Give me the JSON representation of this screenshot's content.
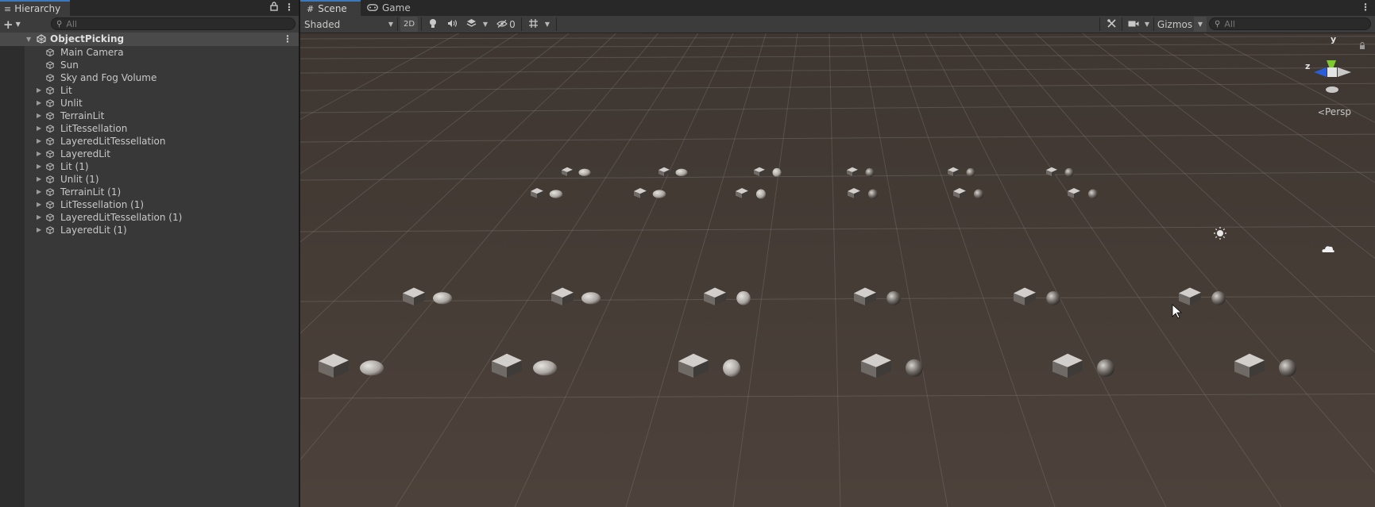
{
  "hierarchy": {
    "tab_label": "Hierarchy",
    "search_placeholder": "All",
    "scene_name": "ObjectPicking",
    "items": [
      {
        "label": "Main Camera",
        "expandable": false
      },
      {
        "label": "Sun",
        "expandable": false
      },
      {
        "label": "Sky and Fog Volume",
        "expandable": false
      },
      {
        "label": "Lit",
        "expandable": true
      },
      {
        "label": "Unlit",
        "expandable": true
      },
      {
        "label": "TerrainLit",
        "expandable": true
      },
      {
        "label": "LitTessellation",
        "expandable": true
      },
      {
        "label": "LayeredLitTessellation",
        "expandable": true
      },
      {
        "label": "LayeredLit",
        "expandable": true
      },
      {
        "label": "Lit (1)",
        "expandable": true
      },
      {
        "label": "Unlit (1)",
        "expandable": true
      },
      {
        "label": "TerrainLit (1)",
        "expandable": true
      },
      {
        "label": "LitTessellation (1)",
        "expandable": true
      },
      {
        "label": "LayeredLitTessellation (1)",
        "expandable": true
      },
      {
        "label": "LayeredLit (1)",
        "expandable": true
      }
    ]
  },
  "scene_view": {
    "tabs": [
      {
        "label": "Scene"
      },
      {
        "label": "Game"
      }
    ],
    "draw_mode": "Shaded",
    "mode_2d": "2D",
    "hidden_count": "0",
    "gizmos_label": "Gizmos",
    "search_placeholder": "All",
    "projection_label": "Persp",
    "axis_y": "y",
    "axis_z": "z"
  },
  "icons": {
    "hierarchy_tab": "hierarchy-list-icon",
    "lock": "lock-icon",
    "menu": "kebab-menu-icon",
    "scene_tab": "grid-icon",
    "game_tab": "gamepad-icon",
    "lighting": "lightbulb-icon",
    "audio": "speaker-icon",
    "effects": "layers-icon",
    "visibility": "eye-slash-icon",
    "grid": "grid-snap-icon",
    "tools": "tools-icon",
    "camera": "camera-icon",
    "sun_light": "sun-icon",
    "cloud_volume": "cloud-icon",
    "cursor": "mouse-pointer-icon"
  },
  "colors": {
    "accent_tab": "#3a79bb",
    "panel_bg": "#383838",
    "ground": "#4b4039",
    "axis_y": "#7ec92f",
    "axis_z": "#2a5dd9",
    "axis_x_neg": "#c8c8c8"
  }
}
